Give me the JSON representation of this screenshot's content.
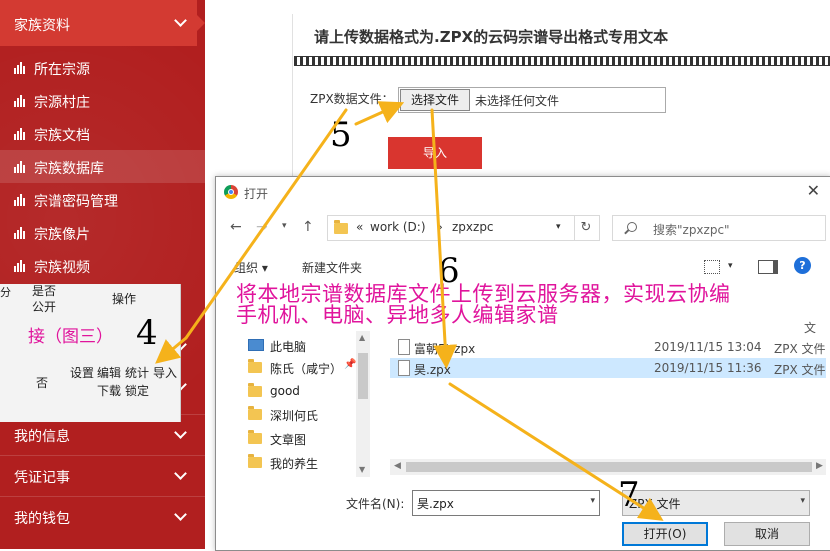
{
  "sidebar": {
    "header": "家族资料",
    "items": [
      {
        "label": "所在宗源"
      },
      {
        "label": "宗源村庄"
      },
      {
        "label": "宗族文档"
      },
      {
        "label": "宗族数据库"
      },
      {
        "label": "宗谱密码管理"
      },
      {
        "label": "宗族像片"
      },
      {
        "label": "宗族视频"
      }
    ],
    "sections": [
      {
        "label": "我的信息"
      },
      {
        "label": "凭证记事"
      },
      {
        "label": "我的钱包"
      }
    ]
  },
  "table": {
    "col_public": "是否\n公开",
    "col_public_a": "是否",
    "col_public_b": "公开",
    "col_fen": "分",
    "col_ops": "操作",
    "cell_public": "否",
    "ops": [
      "设置",
      "编辑",
      "统计",
      "导入",
      "下载",
      "锁定"
    ]
  },
  "upload": {
    "title": "请上传数据格式为.ZPX的云码宗谱导出格式专用文本",
    "field_label": "ZPX数据文件：",
    "choose_button": "选择文件",
    "file_status": "未选择任何文件",
    "import_button": "导入"
  },
  "dialog": {
    "title": "打开",
    "breadcrumb_prefix": "«",
    "breadcrumb_drive": "work (D:)",
    "breadcrumb_sep": "›",
    "breadcrumb_folder": "zpxzpc",
    "search_placeholder": "搜索\"zpxzpc\"",
    "organize": "组织 ▾",
    "new_folder": "新建文件夹",
    "help": "?",
    "tree": [
      {
        "label": "此电脑",
        "icon": "pc-icon"
      },
      {
        "label": "陈氏（咸宁）",
        "icon": "folder-icon"
      },
      {
        "label": "good",
        "icon": "folder-icon"
      },
      {
        "label": "深圳何氏",
        "icon": "folder-icon"
      },
      {
        "label": "文章图",
        "icon": "folder-icon"
      },
      {
        "label": "我的养生",
        "icon": "folder-icon"
      }
    ],
    "files": [
      {
        "name": "富朝5t.zpx",
        "date": "2019/11/15 13:04",
        "type": "ZPX 文件"
      },
      {
        "name": "昊.zpx",
        "date": "2019/11/15 11:36",
        "type": "ZPX 文件"
      }
    ],
    "column_fragment": "文",
    "filename_label": "文件名(N):",
    "filename_value": "昊.zpx",
    "filetype_value": "ZPX 文件",
    "open_button": "打开(O)",
    "cancel_button": "取消"
  },
  "annotations": {
    "note_left": "接（图三）",
    "banner_line1": "将本地宗谱数据库文件上传到云服务器，实现云协编",
    "banner_line2": "手机机、电脑、异地多人编辑家谱",
    "step4": "4",
    "step5": "5",
    "step6": "6",
    "step7": "7"
  },
  "colors": {
    "sidebar_bg": "#b11f1f",
    "sidebar_active": "#d33a32",
    "import_button": "#d9352f",
    "annotation_text": "#e0149c",
    "arrow": "#f5b21b",
    "selection": "#cde8ff"
  }
}
